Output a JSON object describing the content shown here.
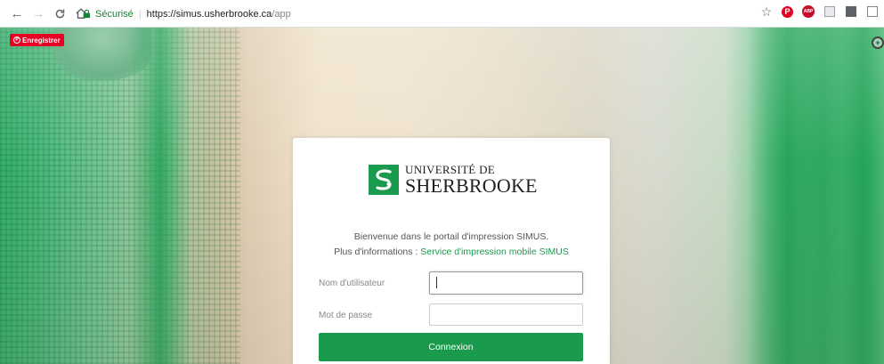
{
  "browser": {
    "secure_label": "Sécurisé",
    "url_host": "https://simus.usherbrooke.ca",
    "url_path": "/app",
    "icons": [
      "back-icon",
      "forward-icon",
      "reload-icon",
      "home-icon",
      "lock-icon",
      "star-icon",
      "pinterest-icon",
      "adblock-icon",
      "extension-icon",
      "extension-icon",
      "document-icon"
    ]
  },
  "pinterest_save": {
    "label": "Enregistrer"
  },
  "login": {
    "brand_colors": {
      "green": "#1a9a4d"
    },
    "logo": {
      "line1": "UNIVERSITÉ DE",
      "line2": "SHERBROOKE"
    },
    "welcome_line1": "Bienvenue dans le portail d'impression SIMUS.",
    "welcome_line2_prefix": "Plus d'informations : ",
    "welcome_link": "Service d'impression mobile SIMUS",
    "username_label": "Nom d'utilisateur",
    "username_value": "",
    "password_label": "Mot de passe",
    "password_value": "",
    "submit_label": "Connexion"
  }
}
